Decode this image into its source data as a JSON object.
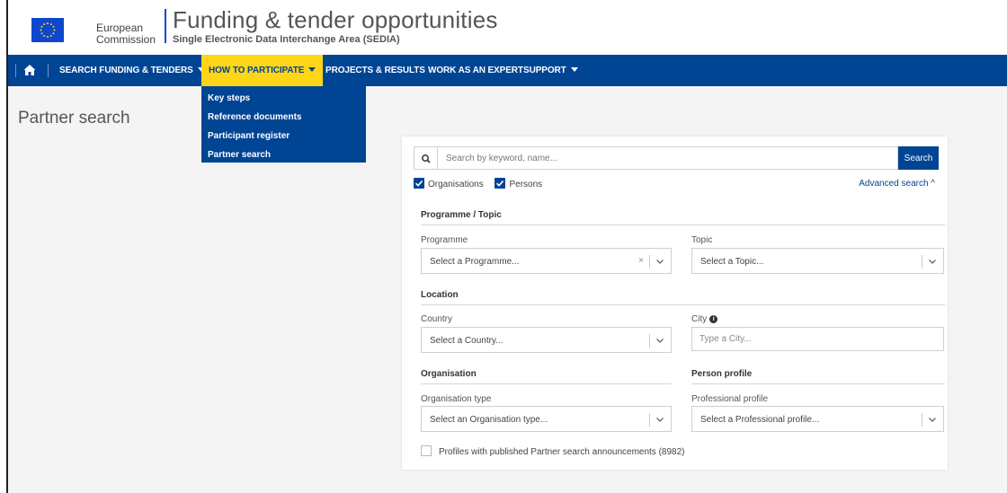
{
  "header": {
    "org_line1": "European",
    "org_line2": "Commission",
    "title": "Funding & tender opportunities",
    "subtitle": "Single Electronic Data Interchange Area (SEDIA)"
  },
  "nav": {
    "home_icon": "home-icon",
    "items": [
      {
        "label": "SEARCH FUNDING & TENDERS",
        "has_caret": true
      },
      {
        "label": "HOW TO PARTICIPATE",
        "has_caret": true,
        "active": true
      },
      {
        "label": "PROJECTS & RESULTS",
        "has_caret": false
      },
      {
        "label": "WORK AS AN EXPERT",
        "has_caret": false
      },
      {
        "label": "SUPPORT",
        "has_caret": true
      }
    ]
  },
  "dropdown": {
    "items": [
      "Key steps",
      "Reference documents",
      "Participant register",
      "Partner search"
    ]
  },
  "page": {
    "title": "Partner search"
  },
  "search": {
    "placeholder": "Search by keyword, name...",
    "button": "Search",
    "organisations_label": "Organisations",
    "organisations_checked": true,
    "persons_label": "Persons",
    "persons_checked": true,
    "advanced_label": "Advanced search ^"
  },
  "programme_topic": {
    "section": "Programme / Topic",
    "programme_label": "Programme",
    "programme_placeholder": "Select a Programme...",
    "topic_label": "Topic",
    "topic_placeholder": "Select a Topic..."
  },
  "location": {
    "section": "Location",
    "country_label": "Country",
    "country_placeholder": "Select a Country...",
    "city_label": "City",
    "city_placeholder": "Type a City..."
  },
  "organisation": {
    "section": "Organisation",
    "type_label": "Organisation type",
    "type_placeholder": "Select an Organisation type..."
  },
  "person_profile": {
    "section": "Person profile",
    "profile_label": "Professional profile",
    "profile_placeholder": "Select a Professional profile..."
  },
  "announcements": {
    "label": "Profiles with published Partner search announcements (8982)",
    "checked": false
  },
  "colors": {
    "nav_blue": "#004494",
    "active_yellow": "#ffd617",
    "eu_blue": "#0e47cb"
  }
}
